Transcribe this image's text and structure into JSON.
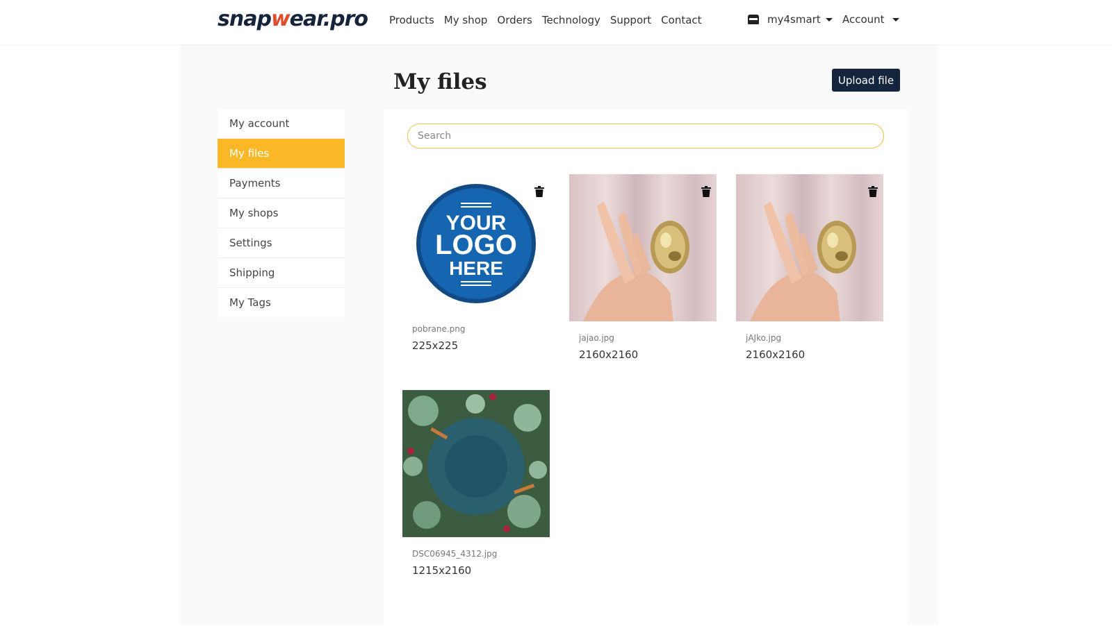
{
  "brand": {
    "logo_prefix": "snap",
    "logo_accent": "w",
    "logo_suffix": "ear.pro"
  },
  "nav": {
    "items": [
      "Products",
      "My shop",
      "Orders",
      "Technology",
      "Support",
      "Contact"
    ],
    "shop_selector": "my4smart",
    "account": "Account"
  },
  "page": {
    "title": "My files",
    "upload_label": "Upload file"
  },
  "sidebar": {
    "items": [
      {
        "label": "My account"
      },
      {
        "label": "My files",
        "active": true
      },
      {
        "label": "Payments"
      },
      {
        "label": "My shops"
      },
      {
        "label": "Settings"
      },
      {
        "label": "Shipping"
      },
      {
        "label": "My Tags"
      }
    ]
  },
  "search": {
    "placeholder": "Search",
    "value": ""
  },
  "files": [
    {
      "name": "pobrane.png",
      "dimensions": "225x225",
      "logo_lines": [
        "YOUR",
        "LOGO",
        "HERE"
      ]
    },
    {
      "name": "jajao.jpg",
      "dimensions": "2160x2160"
    },
    {
      "name": "jAJko.jpg",
      "dimensions": "2160x2160"
    },
    {
      "name": "DSC06945_4312.jpg",
      "dimensions": "1215x2160"
    }
  ],
  "colors": {
    "accent": "#fbb826",
    "brand_dark": "#15253d",
    "logo_blue": "#1565b0"
  },
  "icons": {
    "trash": "trash-icon",
    "store": "store-icon"
  }
}
